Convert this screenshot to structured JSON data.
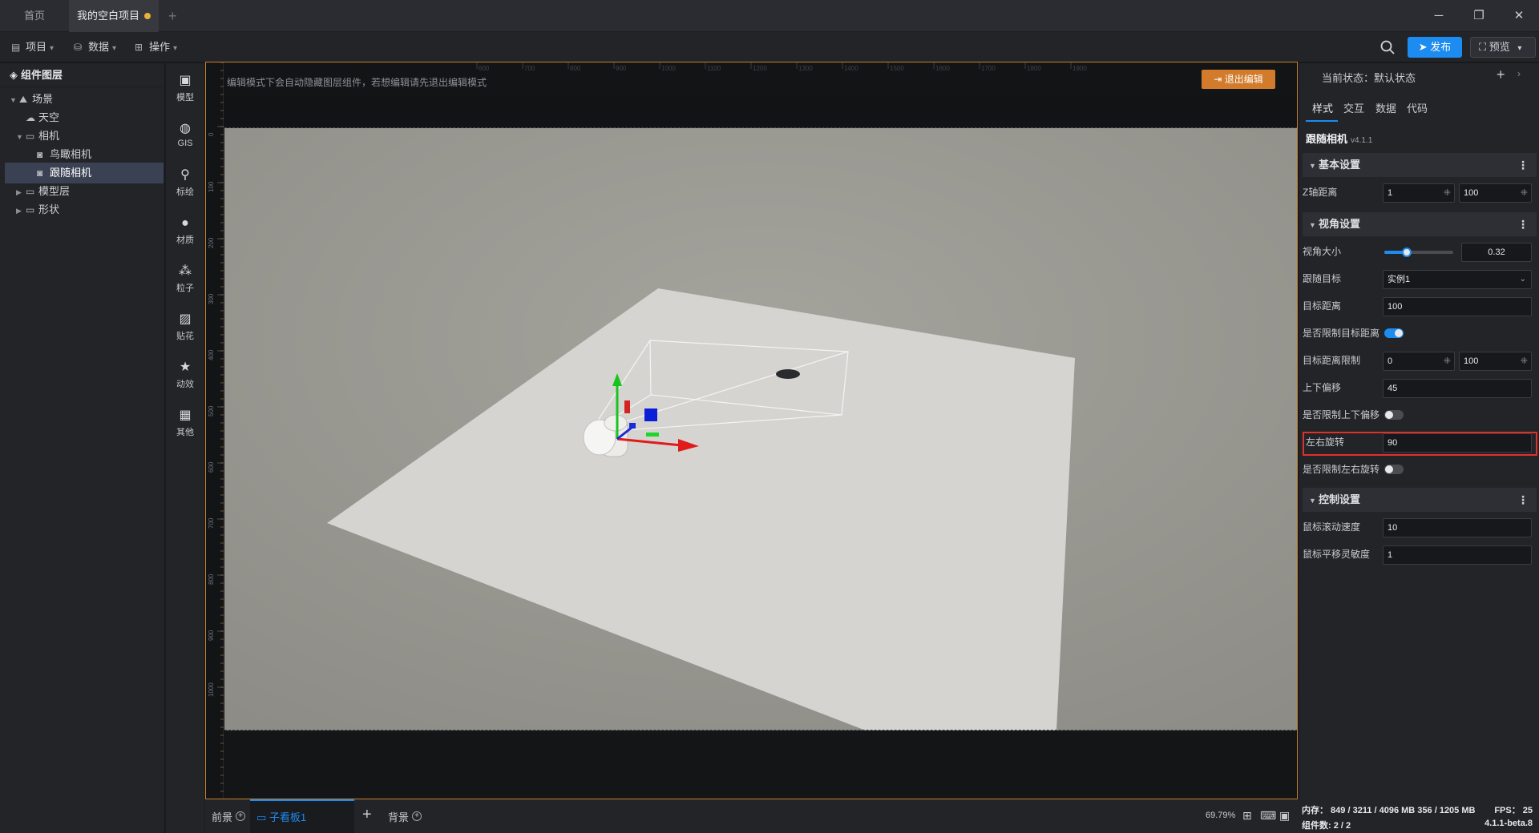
{
  "titlebar": {
    "tab_home": "首页",
    "tab_project": "我的空白项目",
    "tab_add": "+",
    "win_min": "─",
    "win_max": "❐",
    "win_close": "✕"
  },
  "toolbar": {
    "menu_project": "项目",
    "menu_data": "数据",
    "menu_ops": "操作",
    "publish": "发布",
    "preview": "预览"
  },
  "layers": {
    "title": "组件图层",
    "items": [
      {
        "label": "场景",
        "icon": "mountain-icon"
      },
      {
        "label": "天空",
        "icon": "sky-icon"
      },
      {
        "label": "相机",
        "icon": "folder-icon"
      },
      {
        "label": "鸟瞰相机",
        "icon": "camera-icon"
      },
      {
        "label": "跟随相机",
        "icon": "camera-icon"
      },
      {
        "label": "模型层",
        "icon": "folder-icon"
      },
      {
        "label": "形状",
        "icon": "folder-icon"
      }
    ]
  },
  "rail": {
    "items": [
      {
        "label": "模型",
        "icon": "cube-icon"
      },
      {
        "label": "GIS",
        "icon": "globe-icon"
      },
      {
        "label": "标绘",
        "icon": "pin-icon"
      },
      {
        "label": "材质",
        "icon": "sphere-icon"
      },
      {
        "label": "粒子",
        "icon": "particle-icon"
      },
      {
        "label": "贴花",
        "icon": "image-icon"
      },
      {
        "label": "动效",
        "icon": "star-icon"
      },
      {
        "label": "其他",
        "icon": "grid-icon"
      }
    ]
  },
  "editor": {
    "hint": "编辑模式下会自动隐藏图层组件，若想编辑请先退出编辑模式",
    "exit_edit": "退出编辑",
    "ruler_top_ticks": [
      "600",
      "700",
      "800",
      "900",
      "1000",
      "1100",
      "1200",
      "1300",
      "1400",
      "1500",
      "1600",
      "1700",
      "1800",
      "1900"
    ],
    "ruler_left_ticks": [
      "0",
      "100",
      "200",
      "300",
      "400",
      "500",
      "600",
      "700",
      "800",
      "900",
      "1000"
    ]
  },
  "props": {
    "state_label": "当前状态：默认状态",
    "tabs": [
      "样式",
      "交互",
      "数据",
      "代码"
    ],
    "component_name": "跟随相机",
    "component_version": "v4.1.1",
    "sections": {
      "basic": "基本设置",
      "view": "视角设置",
      "control": "控制设置"
    },
    "fields": {
      "z_distance_label": "Z轴距离",
      "z_distance_min": "1",
      "z_distance_max": "100",
      "fov_label": "视角大小",
      "fov_value": "0.32",
      "fov_fraction": 0.32,
      "follow_target_label": "跟随目标",
      "follow_target_value": "实例1",
      "target_distance_label": "目标距离",
      "target_distance_value": "100",
      "limit_target_distance_label": "是否限制目标距离",
      "limit_target_distance_on": true,
      "target_distance_limit_label": "目标距离限制",
      "target_distance_limit_min": "0",
      "target_distance_limit_max": "100",
      "vertical_offset_label": "上下偏移",
      "vertical_offset_value": "45",
      "limit_vertical_offset_label": "是否限制上下偏移",
      "limit_vertical_offset_on": false,
      "horizontal_rotation_label": "左右旋转",
      "horizontal_rotation_value": "90",
      "limit_horizontal_rotation_label": "是否限制左右旋转",
      "limit_horizontal_rotation_on": false,
      "scroll_speed_label": "鼠标滚动速度",
      "scroll_speed_value": "10",
      "pan_sensitivity_label": "鼠标平移灵敏度",
      "pan_sensitivity_value": "1"
    }
  },
  "statusbar": {
    "front": "前景",
    "sub_board": "子看板1",
    "add": "+",
    "back": "背景",
    "zoom": "69.79%"
  },
  "statusinfo": {
    "memory": "内存： 849 / 3211 / 4096 MB  356 / 1205 MB",
    "fps": "FPS： 25",
    "count": "组件数: 2 / 2",
    "version": "4.1.1-beta.8"
  },
  "colors": {
    "accent": "#1d8cf0",
    "edit_border": "#c37f2e",
    "exit_button": "#d27b2b",
    "highlight": "#e0302a",
    "unsaved_dot": "#e8b13a"
  }
}
